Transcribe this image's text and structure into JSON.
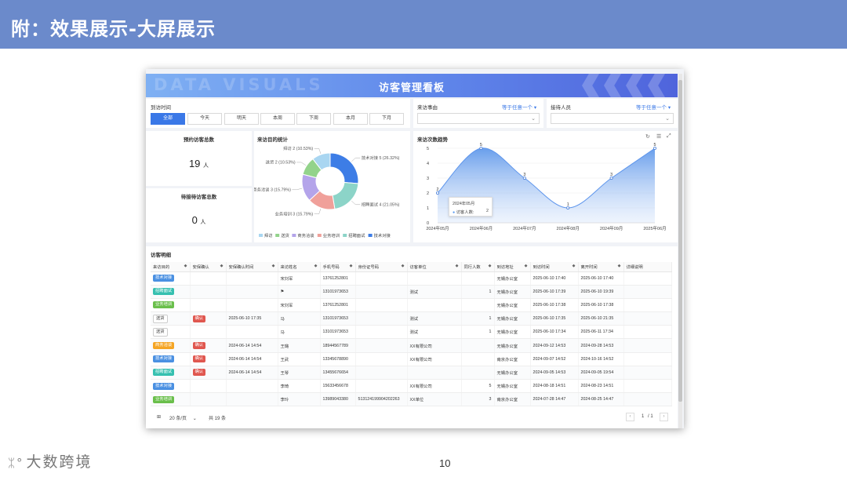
{
  "slide": {
    "title": "附：效果展示-大屏展示",
    "page_number": "10",
    "logo_text": "大数跨境",
    "logo_mark": "ᛯ°"
  },
  "dashboard": {
    "title": "访客管理看板",
    "banner_deco": "DATA VISUALS",
    "filters": {
      "time_label": "到访时间",
      "time_options": [
        "全部",
        "今天",
        "明天",
        "本周",
        "下周",
        "本月",
        "下月"
      ],
      "time_selected": "全部",
      "reason_label": "来访事由",
      "reason_mode": "等于任意一个",
      "reason_value": "",
      "host_label": "接待人员",
      "host_mode": "等于任意一个",
      "host_value": ""
    },
    "stats": {
      "booked_title": "预约访客总数",
      "booked_value": "19",
      "booked_unit": "人",
      "pending_title": "待接待访客总数",
      "pending_value": "0",
      "pending_unit": "人"
    },
    "pie_title": "来访目的统计",
    "line_title": "来访次数趋势",
    "line_tooltip": {
      "title": "2024年05月",
      "series": "访客人数:",
      "value": "2"
    },
    "table_title": "访客明细",
    "columns": [
      "来访目的",
      "安保确认",
      "安保确认时间",
      "来访姓名",
      "手机号码",
      "身份证号码",
      "访客单位",
      "同行人数",
      "到访地址",
      "到访时间",
      "离开时间",
      "详细说明"
    ],
    "rows": [
      {
        "purpose": "技术对接",
        "security": "",
        "security_time": "",
        "name": "宋刘军",
        "phone": "13761252801",
        "id_no": "",
        "company": "",
        "count": "",
        "address": "无锡办公室",
        "arrive": "2025-06-10 17:40",
        "leave": "2025-06-10 17:40",
        "note": ""
      },
      {
        "purpose": "招聘面试",
        "security": "",
        "security_time": "",
        "name": "⚑",
        "phone": "13101973653",
        "id_no": "",
        "company": "测试",
        "count": "1",
        "address": "无锡办公室",
        "arrive": "2025-06-10 17:39",
        "leave": "2025-06-10 19:39",
        "note": ""
      },
      {
        "purpose": "业务培训",
        "security": "",
        "security_time": "",
        "name": "宋刘军",
        "phone": "13761252801",
        "id_no": "",
        "company": "",
        "count": "",
        "address": "无锡办公室",
        "arrive": "2025-06-10 17:38",
        "leave": "2025-06-10 17:38",
        "note": ""
      },
      {
        "purpose": "送货",
        "security": "确认",
        "security_time": "2025-06-10 17:35",
        "name": "马",
        "phone": "13101973653",
        "id_no": "",
        "company": "测试",
        "count": "1",
        "address": "无锡办公室",
        "arrive": "2025-06-10 17:35",
        "leave": "2025-06-10 21:35",
        "note": ""
      },
      {
        "purpose": "送货",
        "security": "",
        "security_time": "",
        "name": "马",
        "phone": "13101973653",
        "id_no": "",
        "company": "测试",
        "count": "1",
        "address": "无锡办公室",
        "arrive": "2025-06-10 17:34",
        "leave": "2025-06-11 17:34",
        "note": ""
      },
      {
        "purpose": "商务洽谈",
        "security": "确认",
        "security_time": "2024-06-14 14:54",
        "name": "王璐",
        "phone": "18944567789",
        "id_no": "",
        "company": "XX有限公司",
        "count": "",
        "address": "无锡办公室",
        "arrive": "2024-09-12 14:53",
        "leave": "2024-09-28 14:53",
        "note": ""
      },
      {
        "purpose": "技术对接",
        "security": "确认",
        "security_time": "2024-06-14 14:54",
        "name": "王武",
        "phone": "13345678890",
        "id_no": "",
        "company": "XX有限公司",
        "count": "",
        "address": "南京办公室",
        "arrive": "2024-09-07 14:52",
        "leave": "2024-10-16 14:52",
        "note": ""
      },
      {
        "purpose": "招聘面试",
        "security": "确认",
        "security_time": "2024-06-14 14:54",
        "name": "王琴",
        "phone": "13455676654",
        "id_no": "",
        "company": "",
        "count": "",
        "address": "无锡办公室",
        "arrive": "2024-09-05 14:53",
        "leave": "2024-09-05 19:54",
        "note": ""
      },
      {
        "purpose": "技术对接",
        "security": "",
        "security_time": "",
        "name": "李琦",
        "phone": "15633456678",
        "id_no": "",
        "company": "XX有限公司",
        "count": "5",
        "address": "无锡办公室",
        "arrive": "2024-08-18 14:51",
        "leave": "2024-08-23 14:51",
        "note": ""
      },
      {
        "purpose": "业务培训",
        "security": "",
        "security_time": "",
        "name": "李玲",
        "phone": "13989043380",
        "id_no": "513124199904202263",
        "company": "XX单位",
        "count": "3",
        "address": "南京办公室",
        "arrive": "2024-07-28 14:47",
        "leave": "2024-08-25 14:47",
        "note": ""
      }
    ],
    "pagination": {
      "page_size": "20 条/页",
      "total": "共 19 条",
      "current": "1",
      "pages": "/ 1"
    }
  },
  "colors": {
    "primary": "#3a78e7",
    "tag": {
      "技术对接": "#4a90e2",
      "招聘面试": "#36c0b0",
      "业务培训": "#6abf4b",
      "商务洽谈": "#f5a524",
      "送货": "outline",
      "确认": "#e0574f"
    }
  },
  "chart_data": [
    {
      "type": "pie",
      "title": "来访目的统计",
      "categories": [
        "技术对接",
        "招聘面试",
        "业务培训",
        "商务洽谈",
        "送货",
        "拜访"
      ],
      "values": [
        5,
        4,
        3,
        3,
        2,
        2
      ],
      "labels": [
        "技术对接 5 (26.32%)",
        "招聘面试 4 (21.05%)",
        "业务培训 3 (15.79%)",
        "商务洽谈 3 (15.79%)",
        "送货 2 (10.53%)",
        "拜访 2 (10.53%)"
      ],
      "legend": [
        "拜访",
        "送货",
        "商务洽谈",
        "业务培训",
        "招聘面试",
        "技术对接"
      ],
      "colors": [
        "#3d7de6",
        "#8cd4c8",
        "#f0a09a",
        "#b4a4ea",
        "#93d38b",
        "#a9d6f1"
      ],
      "legend_colors": [
        "#a9d6f1",
        "#93d38b",
        "#b4a4ea",
        "#f0a09a",
        "#8cd4c8",
        "#3d7de6"
      ],
      "legend_position": "bottom"
    },
    {
      "type": "area",
      "title": "来访次数趋势",
      "categories": [
        "2024年05月",
        "2024年06月",
        "2024年07月",
        "2024年08月",
        "2024年09月",
        "2025年06月"
      ],
      "series": [
        {
          "name": "访客人数",
          "values": [
            2,
            5,
            3,
            1,
            3,
            5
          ]
        }
      ],
      "ylim": [
        0,
        5
      ],
      "yticks": [
        0,
        1,
        2,
        3,
        4,
        5
      ],
      "grid": true
    }
  ]
}
